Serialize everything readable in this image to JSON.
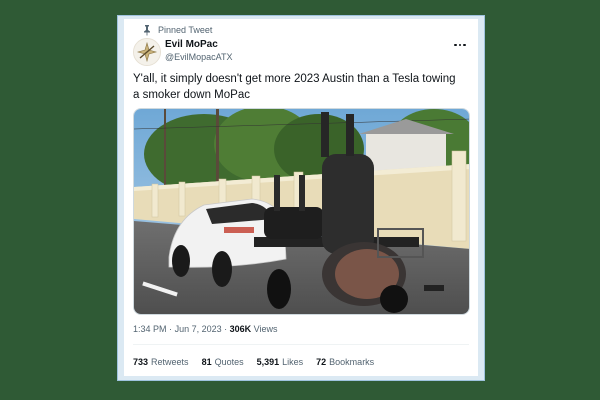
{
  "pinned_label": "Pinned Tweet",
  "author": {
    "name": "Evil MoPac",
    "handle": "@EvilMopacATX"
  },
  "tweet_text": "Y'all, it simply doesn't get more 2023 Austin than a Tesla towing a smoker down MoPac",
  "meta": {
    "time": "1:34 PM",
    "separator": "·",
    "date": "Jun 7, 2023",
    "views_count": "306K",
    "views_label": "Views"
  },
  "stats": [
    {
      "count": "733",
      "label": "Retweets"
    },
    {
      "count": "81",
      "label": "Quotes"
    },
    {
      "count": "5,391",
      "label": "Likes"
    },
    {
      "count": "72",
      "label": "Bookmarks"
    }
  ],
  "icons": {
    "pinned": "pin-icon",
    "more": "more-options-icon"
  },
  "colors": {
    "background": "#2f5a35",
    "card": "#ffffff",
    "text": "#0f1419",
    "secondary": "#536471"
  }
}
